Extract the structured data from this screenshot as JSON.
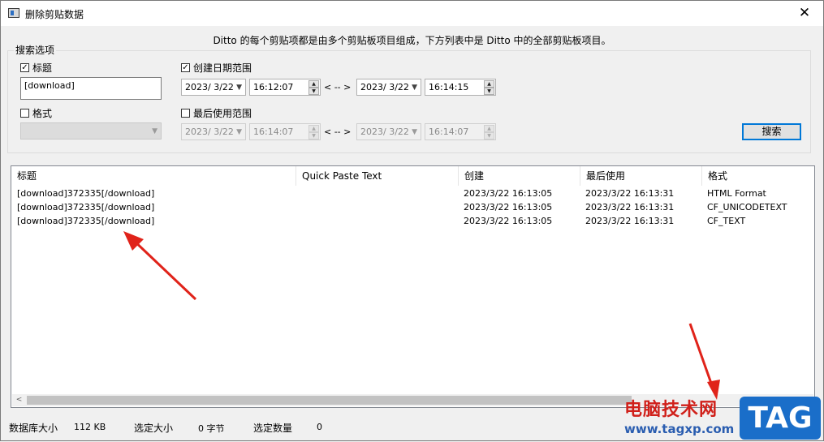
{
  "window": {
    "title": "删除剪贴数据",
    "close_glyph": "✕"
  },
  "description": "Ditto 的每个剪贴项都是由多个剪贴板项目组成，下方列表中是 Ditto 中的全部剪贴板项目。",
  "search_options": {
    "group_label": "搜索选项",
    "title_check": {
      "label": "标题",
      "checked": true
    },
    "title_value": "[download]",
    "format_check": {
      "label": "格式",
      "checked": false
    },
    "format_value": "",
    "created_check": {
      "label": "创建日期范围",
      "checked": true
    },
    "created": {
      "from_date": "2023/ 3/22",
      "from_time": "16:12:07",
      "separator": "< -- >",
      "to_date": "2023/ 3/22",
      "to_time": "16:14:15"
    },
    "lastused_check": {
      "label": "最后使用范围",
      "checked": false
    },
    "lastused": {
      "from_date": "2023/ 3/22",
      "from_time": "16:14:07",
      "separator": "< -- >",
      "to_date": "2023/ 3/22",
      "to_time": "16:14:07"
    },
    "search_button": "搜索"
  },
  "list": {
    "columns": [
      "标题",
      "Quick Paste Text",
      "创建",
      "最后使用",
      "格式"
    ],
    "rows": [
      {
        "title": "[download]372335[/download]",
        "quick": "",
        "created": "2023/3/22 16:13:05",
        "last_used": "2023/3/22 16:13:31",
        "format": "HTML Format"
      },
      {
        "title": "[download]372335[/download]",
        "quick": "",
        "created": "2023/3/22 16:13:05",
        "last_used": "2023/3/22 16:13:31",
        "format": "CF_UNICODETEXT"
      },
      {
        "title": "[download]372335[/download]",
        "quick": "",
        "created": "2023/3/22 16:13:05",
        "last_used": "2023/3/22 16:13:31",
        "format": "CF_TEXT"
      }
    ],
    "scroll_left_glyph": "<"
  },
  "status": {
    "db_size_label": "数据库大小",
    "db_size_value": "112 KB",
    "selected_size_label": "选定大小",
    "selected_size_value": "0 字节",
    "selected_count_label": "选定数量",
    "selected_count_value": "0"
  },
  "watermark": {
    "cn": "电脑技术网",
    "url": "www.tagxp.com",
    "tag": "TAG"
  },
  "colors": {
    "accent": "#0078d7",
    "arrow": "#e0231a",
    "watermark_red": "#d0201a",
    "watermark_blue": "#1a6ec9"
  }
}
